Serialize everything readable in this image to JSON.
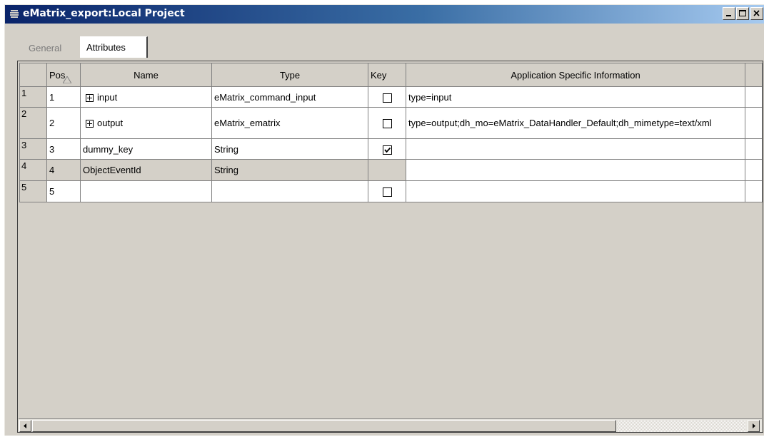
{
  "window": {
    "title": "eMatrix_export:Local Project"
  },
  "tabs": [
    {
      "label": "General",
      "active": false
    },
    {
      "label": "Attributes",
      "active": true
    }
  ],
  "grid": {
    "columns": [
      "Pos",
      "Name",
      "Type",
      "Key",
      "Application Specific Information"
    ],
    "rows": [
      {
        "row": "1",
        "pos": "1",
        "name": "input",
        "expandable": true,
        "type": "eMatrix_command_input",
        "key": "unchecked",
        "asi": "type=input"
      },
      {
        "row": "2",
        "pos": "2",
        "name": "output",
        "expandable": true,
        "type": "eMatrix_ematrix",
        "key": "unchecked",
        "asi": "type=output;dh_mo=eMatrix_DataHandler_Default;dh_mimetype=text/xml"
      },
      {
        "row": "3",
        "pos": "3",
        "name": "dummy_key",
        "expandable": false,
        "type": "String",
        "key": "checked",
        "asi": ""
      },
      {
        "row": "4",
        "pos": "4",
        "name": "ObjectEventId",
        "expandable": false,
        "type": "String",
        "key": "none",
        "asi": ""
      },
      {
        "row": "5",
        "pos": "5",
        "name": "",
        "expandable": false,
        "type": "",
        "key": "unchecked",
        "asi": ""
      }
    ]
  },
  "colors": {
    "title_start": "#0a246a",
    "title_end": "#a6caf0",
    "chrome": "#d4d0c8"
  },
  "icons": [
    "window-icon",
    "minimize-icon",
    "maximize-icon",
    "close-icon",
    "sort-icon",
    "expand-icon",
    "scroll-left-icon",
    "scroll-right-icon"
  ]
}
